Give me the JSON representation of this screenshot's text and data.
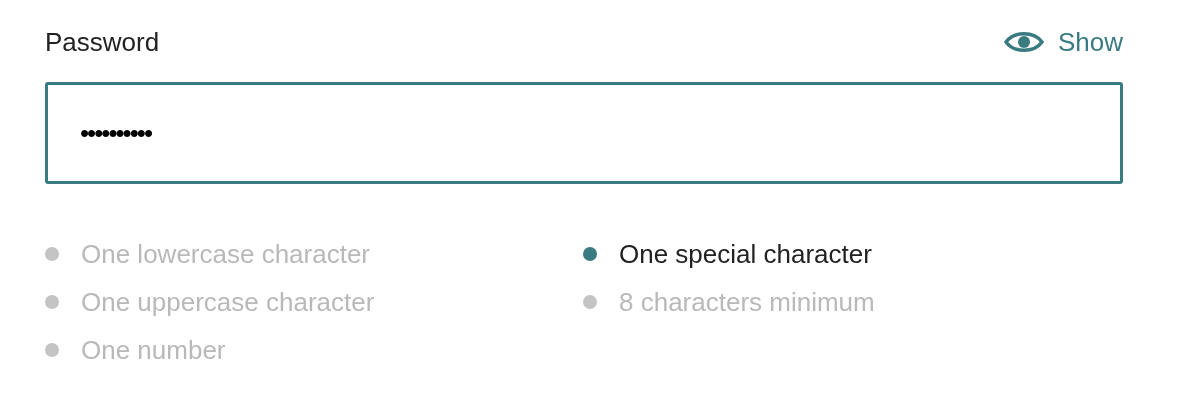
{
  "field": {
    "label": "Password",
    "toggle": {
      "label": "Show"
    },
    "value": "••••••••••",
    "focused": true
  },
  "requirements": [
    {
      "text": "One lowercase character",
      "met": false
    },
    {
      "text": "One uppercase character",
      "met": false
    },
    {
      "text": "One number",
      "met": false
    },
    {
      "text": "One special character",
      "met": true
    },
    {
      "text": "8 characters minimum",
      "met": false
    }
  ]
}
